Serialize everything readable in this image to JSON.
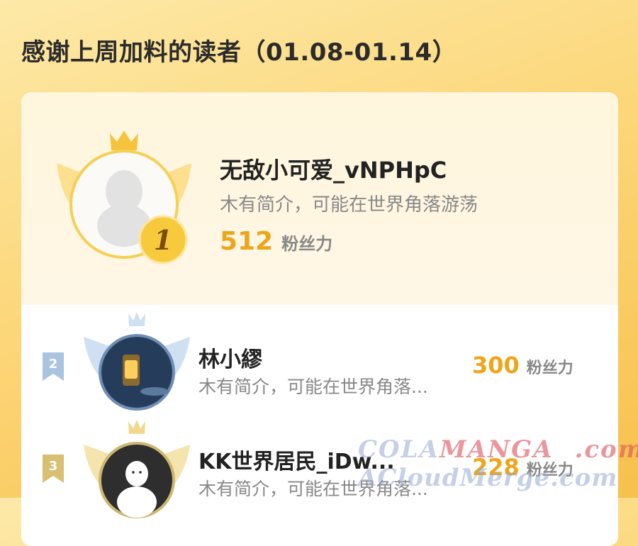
{
  "page": {
    "title": "感谢上周加料的读者（01.08-01.14）"
  },
  "first": {
    "rank": "1",
    "name": "无敌小可爱_vNPHpC",
    "bio": "木有简介，可能在世界角落游荡",
    "fans_count": "512",
    "fans_label": "粉丝力"
  },
  "list": [
    {
      "rank": "2",
      "name": "林小繆",
      "bio": "木有简介，可能在世界角落...",
      "fans_count": "300",
      "fans_label": "粉丝力"
    },
    {
      "rank": "3",
      "name": "KK世界居民_iDw...",
      "bio": "木有简介，可能在世界角落...",
      "fans_count": "228",
      "fans_label": "粉丝力"
    }
  ],
  "watermark": {
    "line1_a": "COLA",
    "line1_b": "MANGA",
    "line1_c": ".com",
    "line2": "ACloudMerge.com"
  },
  "colors": {
    "accent": "#eea51a",
    "gold": "#f4c33b",
    "silver": "#aac3de",
    "bronze": "#d8bf72"
  }
}
